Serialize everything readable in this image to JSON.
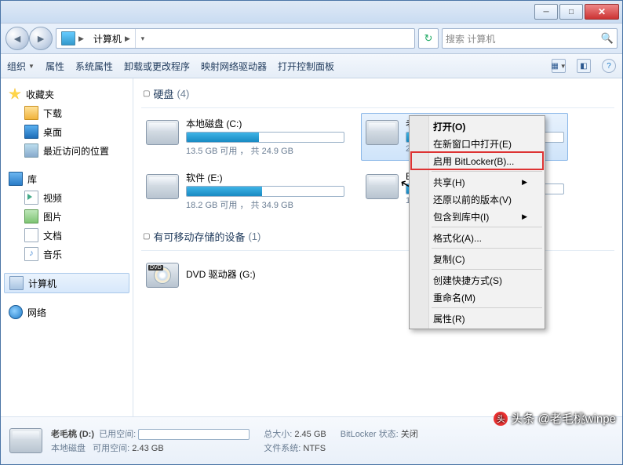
{
  "breadcrumb": {
    "root_label": "计算机"
  },
  "search": {
    "placeholder": "搜索 计算机"
  },
  "toolbar": {
    "organize": "组织",
    "properties": "属性",
    "sys_properties": "系统属性",
    "uninstall": "卸载或更改程序",
    "map_drive": "映射网络驱动器",
    "control_panel": "打开控制面板"
  },
  "sidebar": {
    "favorites": "收藏夹",
    "downloads": "下载",
    "desktop": "桌面",
    "recent": "最近访问的位置",
    "libraries": "库",
    "videos": "视频",
    "pictures": "图片",
    "documents": "文档",
    "music": "音乐",
    "computer": "计算机",
    "network": "网络"
  },
  "groups": {
    "hdd": {
      "label": "硬盘",
      "count": "(4)"
    },
    "removable": {
      "label": "有可移动存储的设备",
      "count": "(1)"
    }
  },
  "drives": {
    "c": {
      "name": "本地磁盘 (C:)",
      "sub": "13.5 GB 可用 ， 共 24.9 GB",
      "pct": 46
    },
    "d": {
      "name": "老毛桃 (D:)",
      "sub": "2.4",
      "pct": 2
    },
    "e": {
      "name": "软件 (E:)",
      "sub": "18.2 GB 可用 ， 共 34.9 GB",
      "pct": 48
    },
    "f": {
      "name": "EF",
      "sub": "11",
      "pct": 10
    },
    "g": {
      "name": "DVD 驱动器 (G:)"
    }
  },
  "context_menu": {
    "open": "打开(O)",
    "open_new": "在新窗口中打开(E)",
    "bitlocker": "启用 BitLocker(B)...",
    "share": "共享(H)",
    "restore": "还原以前的版本(V)",
    "include": "包含到库中(I)",
    "format": "格式化(A)...",
    "copy": "复制(C)",
    "shortcut": "创建快捷方式(S)",
    "rename": "重命名(M)",
    "props": "属性(R)"
  },
  "details": {
    "title": "老毛桃 (D:)",
    "subtitle": "本地磁盘",
    "used_k": "已用空间:",
    "free_k": "可用空间:",
    "free_v": "2.43 GB",
    "total_k": "总大小:",
    "total_v": "2.45 GB",
    "fs_k": "文件系统:",
    "fs_v": "NTFS",
    "bl_k": "BitLocker 状态:",
    "bl_v": "关闭"
  },
  "watermark": "头条 @老毛桃winpe"
}
